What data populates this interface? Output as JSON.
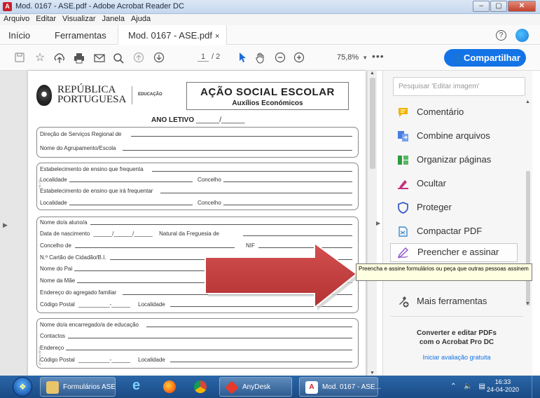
{
  "window": {
    "title": "Mod. 0167 - ASE.pdf - Adobe Acrobat Reader DC",
    "app_icon": "acrobat-icon"
  },
  "menu": [
    "Arquivo",
    "Editar",
    "Visualizar",
    "Janela",
    "Ajuda"
  ],
  "tabs": {
    "home": "Início",
    "tools": "Ferramentas",
    "doc": "Mod. 0167 - ASE.pdf",
    "close": "×"
  },
  "toolbar": {
    "page_current": "1",
    "page_total": "/ 2",
    "zoom": "75,8%",
    "more": "•••",
    "share_label": "Compartilhar",
    "accent": "#1473e6"
  },
  "document": {
    "logo_line1": "REPÚBLICA",
    "logo_line2": "PORTUGUESA",
    "dept": "EDUCAÇÃO",
    "title": "AÇÃO SOCIAL ESCOLAR",
    "subtitle": "Auxílios Económicos",
    "ano_letivo": "ANO LETIVO",
    "ano_letivo_blank": "______/______",
    "box1": [
      "Direção de Serviços Regional de",
      "Nome do Agrupamento/Escola"
    ],
    "box2": {
      "estab": "Estabelecimento de ensino que frequenta",
      "localidade": "Localidade",
      "concelho": "Concelho",
      "estab_futuro": "Estabelecimento de ensino que irá frequentar",
      "side": "(01.17)"
    },
    "box3": {
      "nome": "Nome do/a aluno/a",
      "nascimento": "Data de nascimento",
      "nasc_blank": "______/______/______",
      "freguesia": "Natural da Freguesia de",
      "concelho": "Concelho de",
      "nif": "NIF",
      "cartao": "N.º Cartão de Cidadão/B.I.",
      "pai": "Nome do Pai",
      "mae": "Nome da Mãe",
      "endereco": "Endereço do agregado familiar",
      "codigo_postal": "Código Postal",
      "cp_blank": "__________-______",
      "localidade": "Localidade"
    },
    "box4": {
      "encarregado": "Nome do/a encarregado/a de educação",
      "contactos": "Contactos",
      "endereco": "Endereço",
      "codigo_postal": "Código Postal",
      "cp_blank": "__________-______",
      "localidade": "Localidade",
      "side": "(Ciência 2017)"
    }
  },
  "tools": {
    "search_placeholder": "Pesquisar 'Editar imagem'",
    "items": [
      {
        "label": "Comentário",
        "icon": "comment-icon",
        "color": "#f0b400"
      },
      {
        "label": "Combine arquivos",
        "icon": "combine-files-icon",
        "color": "#4a7de0"
      },
      {
        "label": "Organizar páginas",
        "icon": "organize-pages-icon",
        "color": "#2e9b3d"
      },
      {
        "label": "Ocultar",
        "icon": "redact-icon",
        "color": "#c4317d"
      },
      {
        "label": "Proteger",
        "icon": "protect-icon",
        "color": "#3d5cc9"
      },
      {
        "label": "Compactar PDF",
        "icon": "compress-pdf-icon",
        "color": "#3c8dd0"
      },
      {
        "label": "Preencher e assinar",
        "icon": "fill-sign-icon",
        "color": "#8c52c9"
      },
      {
        "label": "Mais ferramentas",
        "icon": "more-tools-icon",
        "color": "#555555"
      }
    ],
    "promo_line1": "Converter e editar PDFs",
    "promo_line2": "com o Acrobat Pro DC",
    "promo_link": "Iniciar avaliação gratuita"
  },
  "tooltip": "Preencha e assine formulários ou peça que outras pessoas assinem",
  "taskbar": {
    "items": [
      {
        "label": "Formulários ASE",
        "icon": "folder-icon"
      },
      {
        "label": "",
        "icon": "ie-icon"
      },
      {
        "label": "",
        "icon": "firefox-icon"
      },
      {
        "label": "",
        "icon": "chrome-icon"
      },
      {
        "label": "AnyDesk",
        "icon": "anydesk-icon"
      },
      {
        "label": "Mod. 0167 - ASE...",
        "icon": "acrobat-icon"
      }
    ],
    "time": "16:33",
    "date": "24-04-2020"
  }
}
